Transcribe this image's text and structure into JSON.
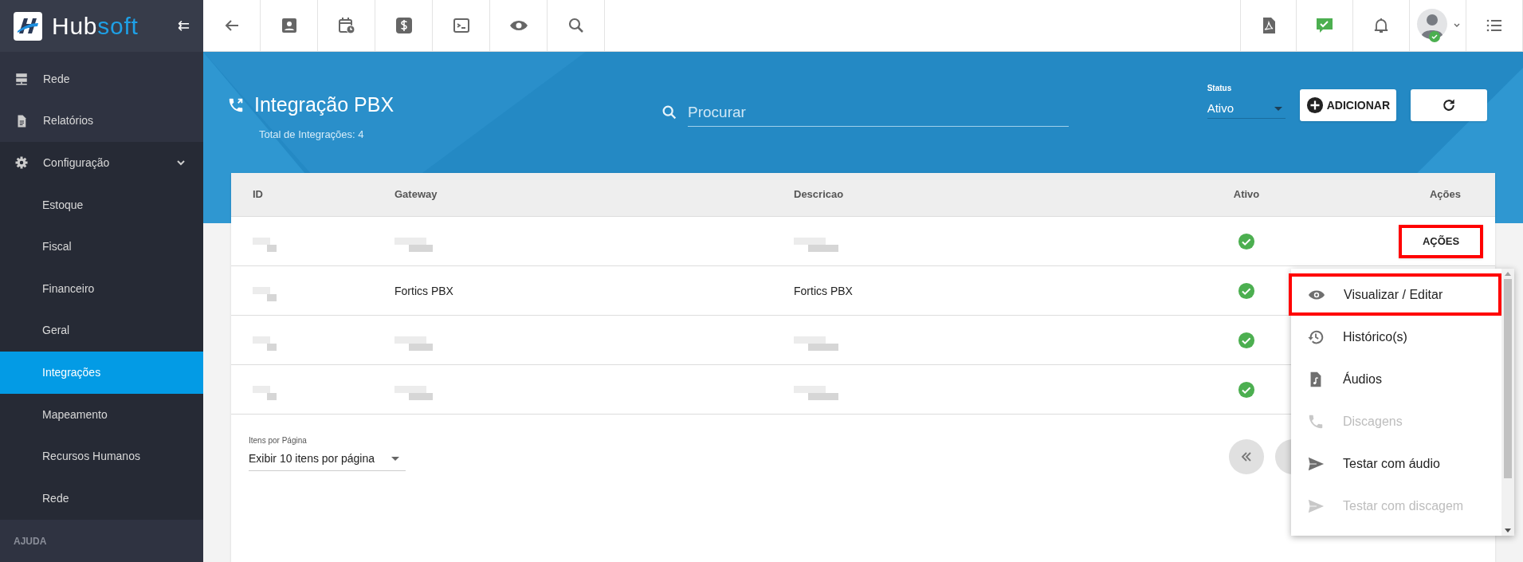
{
  "brand": {
    "name_part_1": "Hub",
    "name_part_2": "soft",
    "collapse_glyph": "⇇"
  },
  "sidebar": {
    "items": [
      {
        "label": "Rede",
        "kind": "server",
        "selected": false
      },
      {
        "label": "Relatórios",
        "kind": "file",
        "selected": false
      },
      {
        "label": "Configuração",
        "kind": "gear",
        "selected": false,
        "expanded": true,
        "children": [
          {
            "label": "Estoque",
            "selected": false
          },
          {
            "label": "Fiscal",
            "selected": false
          },
          {
            "label": "Financeiro",
            "selected": false
          },
          {
            "label": "Geral",
            "selected": false
          },
          {
            "label": "Integrações",
            "selected": true
          },
          {
            "label": "Mapeamento",
            "selected": false
          },
          {
            "label": "Recursos Humanos",
            "selected": false
          },
          {
            "label": "Rede",
            "selected": false
          }
        ]
      }
    ],
    "section_heading": "AJUDA"
  },
  "page": {
    "title": "Integração PBX",
    "subtitle": "Total de Integrações: 4",
    "search": {
      "placeholder": "Procurar"
    },
    "status": {
      "label": "Status",
      "value": "Ativo"
    },
    "add_button": "ADICIONAR"
  },
  "table": {
    "columns": [
      "ID",
      "Gateway",
      "Descricao",
      "Ativo",
      "Ações"
    ],
    "rows": [
      {
        "redacted": true,
        "active": true,
        "actions_button": "AÇÕES"
      },
      {
        "redacted": false,
        "gateway": "Fortics PBX",
        "description": "Fortics PBX",
        "active": true
      },
      {
        "redacted": true,
        "active": true
      },
      {
        "redacted": true,
        "active": true
      }
    ],
    "per_page": {
      "label": "Itens por Página",
      "value": "Exibir 10 itens por página"
    }
  },
  "menu": {
    "items": [
      {
        "label": "Visualizar / Editar",
        "kind": "eye",
        "disabled": false,
        "highlighted": true
      },
      {
        "label": "Histórico(s)",
        "kind": "history",
        "disabled": false,
        "highlighted": false
      },
      {
        "label": "Áudios",
        "kind": "audiofile",
        "disabled": false,
        "highlighted": false
      },
      {
        "label": "Discagens",
        "kind": "phone",
        "disabled": true,
        "highlighted": false
      },
      {
        "label": "Testar com áudio",
        "kind": "send",
        "disabled": false,
        "highlighted": false
      },
      {
        "label": "Testar com discagem",
        "kind": "send",
        "disabled": true,
        "highlighted": false
      }
    ]
  }
}
